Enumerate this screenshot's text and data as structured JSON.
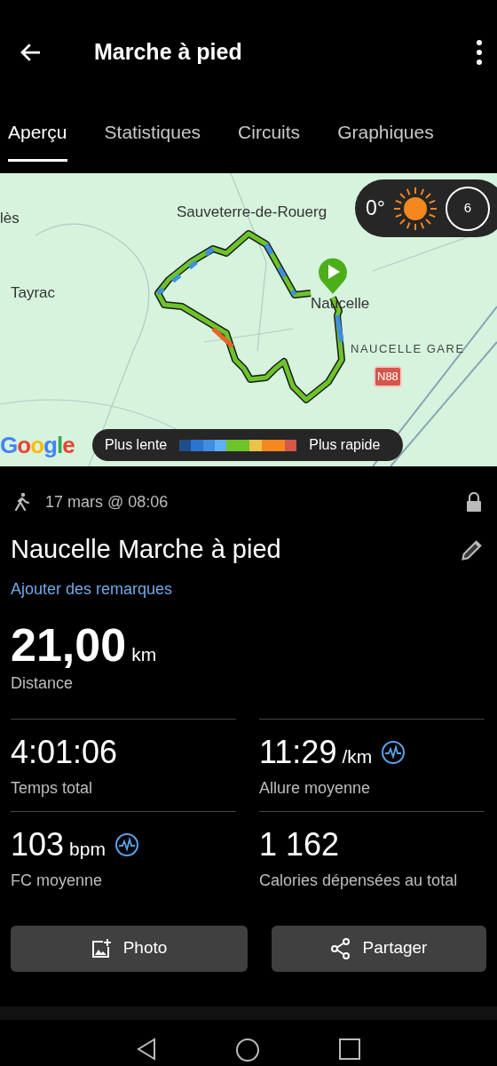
{
  "header": {
    "title": "Marche à pied"
  },
  "tabs": [
    {
      "label": "Aperçu",
      "selected": true
    },
    {
      "label": "Statistiques",
      "selected": false
    },
    {
      "label": "Circuits",
      "selected": false
    },
    {
      "label": "Graphiques",
      "selected": false
    }
  ],
  "map": {
    "labels": [
      {
        "text": "lès",
        "kind": "town"
      },
      {
        "text": "Sauveterre-de-Rouerg",
        "kind": "town"
      },
      {
        "text": "Tayrac",
        "kind": "town"
      },
      {
        "text": "Naucelle",
        "kind": "town"
      },
      {
        "text": "NAUCELLE GARE",
        "kind": "area"
      },
      {
        "text": "N88",
        "kind": "road"
      }
    ],
    "weather": {
      "temperature": "0°",
      "wind": "6"
    },
    "logo": "Google",
    "legend": {
      "slow": "Plus lente",
      "fast": "Plus rapide"
    }
  },
  "activity": {
    "date": "17 mars @ 08:06",
    "title": "Naucelle Marche à pied",
    "notes_link": "Ajouter des remarques"
  },
  "distance": {
    "value": "21,00",
    "unit": "km",
    "label": "Distance"
  },
  "stats": [
    {
      "value": "4:01:06",
      "label": "Temps total",
      "chart_icon": false
    },
    {
      "value": "11:29",
      "unit": "/km",
      "label": "Allure moyenne",
      "chart_icon": true
    },
    {
      "value": "103",
      "unit": "bpm",
      "label": "FC moyenne",
      "chart_icon": true
    },
    {
      "value": "1 162",
      "label": "Calories dépensées au total",
      "chart_icon": false
    }
  ],
  "buttons": [
    {
      "label": "Photo",
      "kind": "photo"
    },
    {
      "label": "Partager",
      "kind": "share"
    }
  ]
}
